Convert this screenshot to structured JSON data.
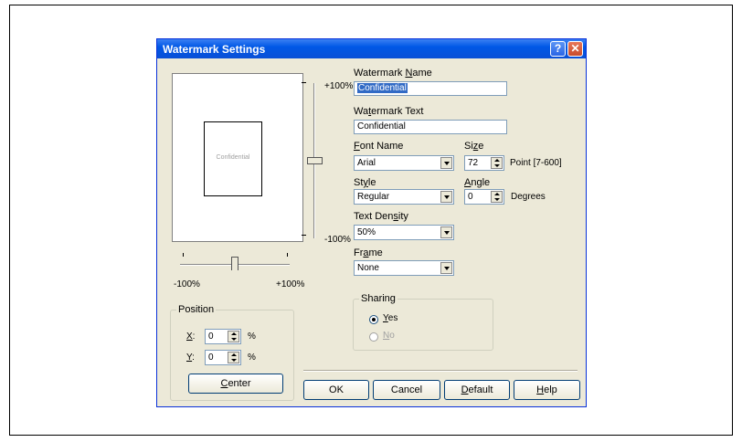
{
  "window": {
    "title": "Watermark Settings",
    "help_glyph": "?",
    "close_glyph": "✕"
  },
  "preview": {
    "text": "Confidential"
  },
  "hslider": {
    "min_label": "-100%",
    "max_label": "+100%",
    "value_percent": 0
  },
  "vslider": {
    "top_label": "+100%",
    "bottom_label": "-100%",
    "value_percent": 0
  },
  "position": {
    "title": "Position",
    "x_label_key": "X",
    "x_label_rest": ":",
    "x_value": "0",
    "x_unit": "%",
    "y_label_key": "Y",
    "y_label_rest": ":",
    "y_value": "0",
    "y_unit": "%",
    "center_key": "C",
    "center_rest": "enter"
  },
  "watermark_name": {
    "label_pre": "Watermark ",
    "label_key": "N",
    "label_post": "ame",
    "value": "Confidential"
  },
  "watermark_text": {
    "label_pre": "Wa",
    "label_key": "t",
    "label_post": "ermark Text",
    "value": "Confidential"
  },
  "font_name": {
    "label_key": "F",
    "label_post": "ont Name",
    "value": "Arial"
  },
  "size": {
    "label_pre": "Si",
    "label_key": "z",
    "label_post": "e",
    "value": "72",
    "unit": "Point [7-600]"
  },
  "style": {
    "label_pre": "St",
    "label_key": "y",
    "label_post": "le",
    "value": "Regular"
  },
  "angle": {
    "label_key": "A",
    "label_post": "ngle",
    "value": "0",
    "unit": "Degrees"
  },
  "density": {
    "label_pre": "Text Den",
    "label_key": "s",
    "label_post": "ity",
    "value": "50%"
  },
  "frame": {
    "label_pre": "Fr",
    "label_key": "a",
    "label_post": "me",
    "value": "None"
  },
  "sharing": {
    "title": "Sharing",
    "yes_pre": "",
    "yes_key": "Y",
    "yes_post": "es",
    "no_key": "N",
    "no_post": "o",
    "selected": "yes"
  },
  "buttons": {
    "ok": "OK",
    "cancel": "Cancel",
    "default_key": "D",
    "default_rest": "efault",
    "help_key": "H",
    "help_rest": "elp"
  }
}
